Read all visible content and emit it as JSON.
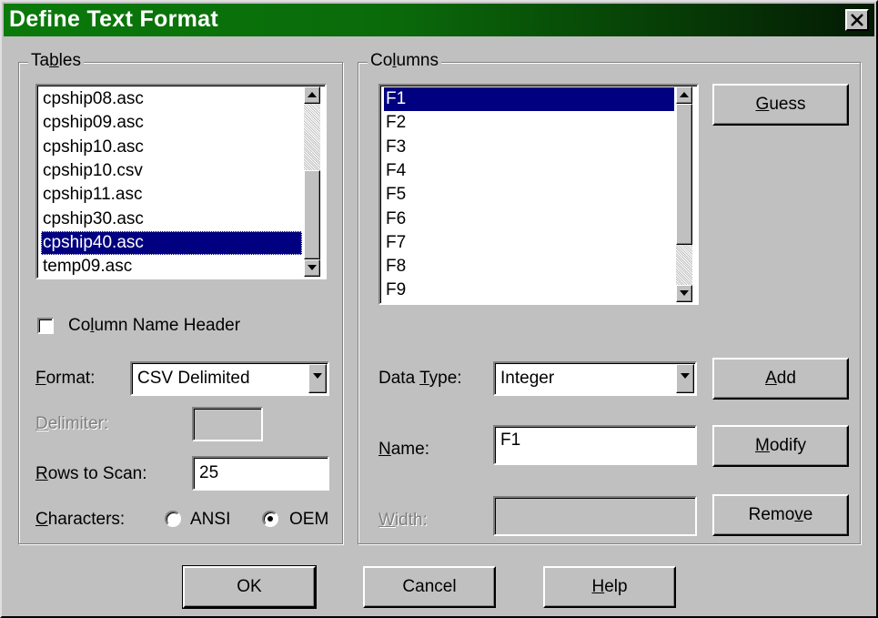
{
  "window": {
    "title": "Define Text Format"
  },
  "tables": {
    "label": "Tables",
    "items": [
      "cpship08.asc",
      "cpship09.asc",
      "cpship10.asc",
      "cpship10.csv",
      "cpship11.asc",
      "cpship30.asc",
      "cpship40.asc",
      "temp09.asc"
    ],
    "selected": "cpship40.asc",
    "column_name_header": {
      "label": "Column Name Header",
      "checked": false
    },
    "format": {
      "label": "Format:",
      "value": "CSV Delimited"
    },
    "delimiter": {
      "label": "Delimiter:",
      "value": "",
      "disabled": true
    },
    "rows_to_scan": {
      "label": "Rows to Scan:",
      "value": "25"
    },
    "characters": {
      "label": "Characters:",
      "options": [
        "ANSI",
        "OEM"
      ],
      "selected": "OEM"
    }
  },
  "columns": {
    "label": "Columns",
    "items": [
      "F1",
      "F2",
      "F3",
      "F4",
      "F5",
      "F6",
      "F7",
      "F8",
      "F9"
    ],
    "selected": "F1",
    "guess_label": "Guess",
    "data_type": {
      "label": "Data Type:",
      "value": "Integer"
    },
    "add_label": "Add",
    "name": {
      "label": "Name:",
      "value": "F1"
    },
    "modify_label": "Modify",
    "width": {
      "label": "Width:",
      "value": "",
      "disabled": true
    },
    "remove_label": "Remove"
  },
  "footer": {
    "ok_label": "OK",
    "cancel_label": "Cancel",
    "help_label": "Help"
  },
  "colors": {
    "title_bar": "#0a7a0a",
    "selection": "#000080",
    "face": "#c0c0c0"
  },
  "icons": {
    "close": "close-icon",
    "scroll_up": "scroll-up-arrow-icon",
    "scroll_down": "scroll-down-arrow-icon",
    "dropdown": "chevron-down-icon"
  }
}
